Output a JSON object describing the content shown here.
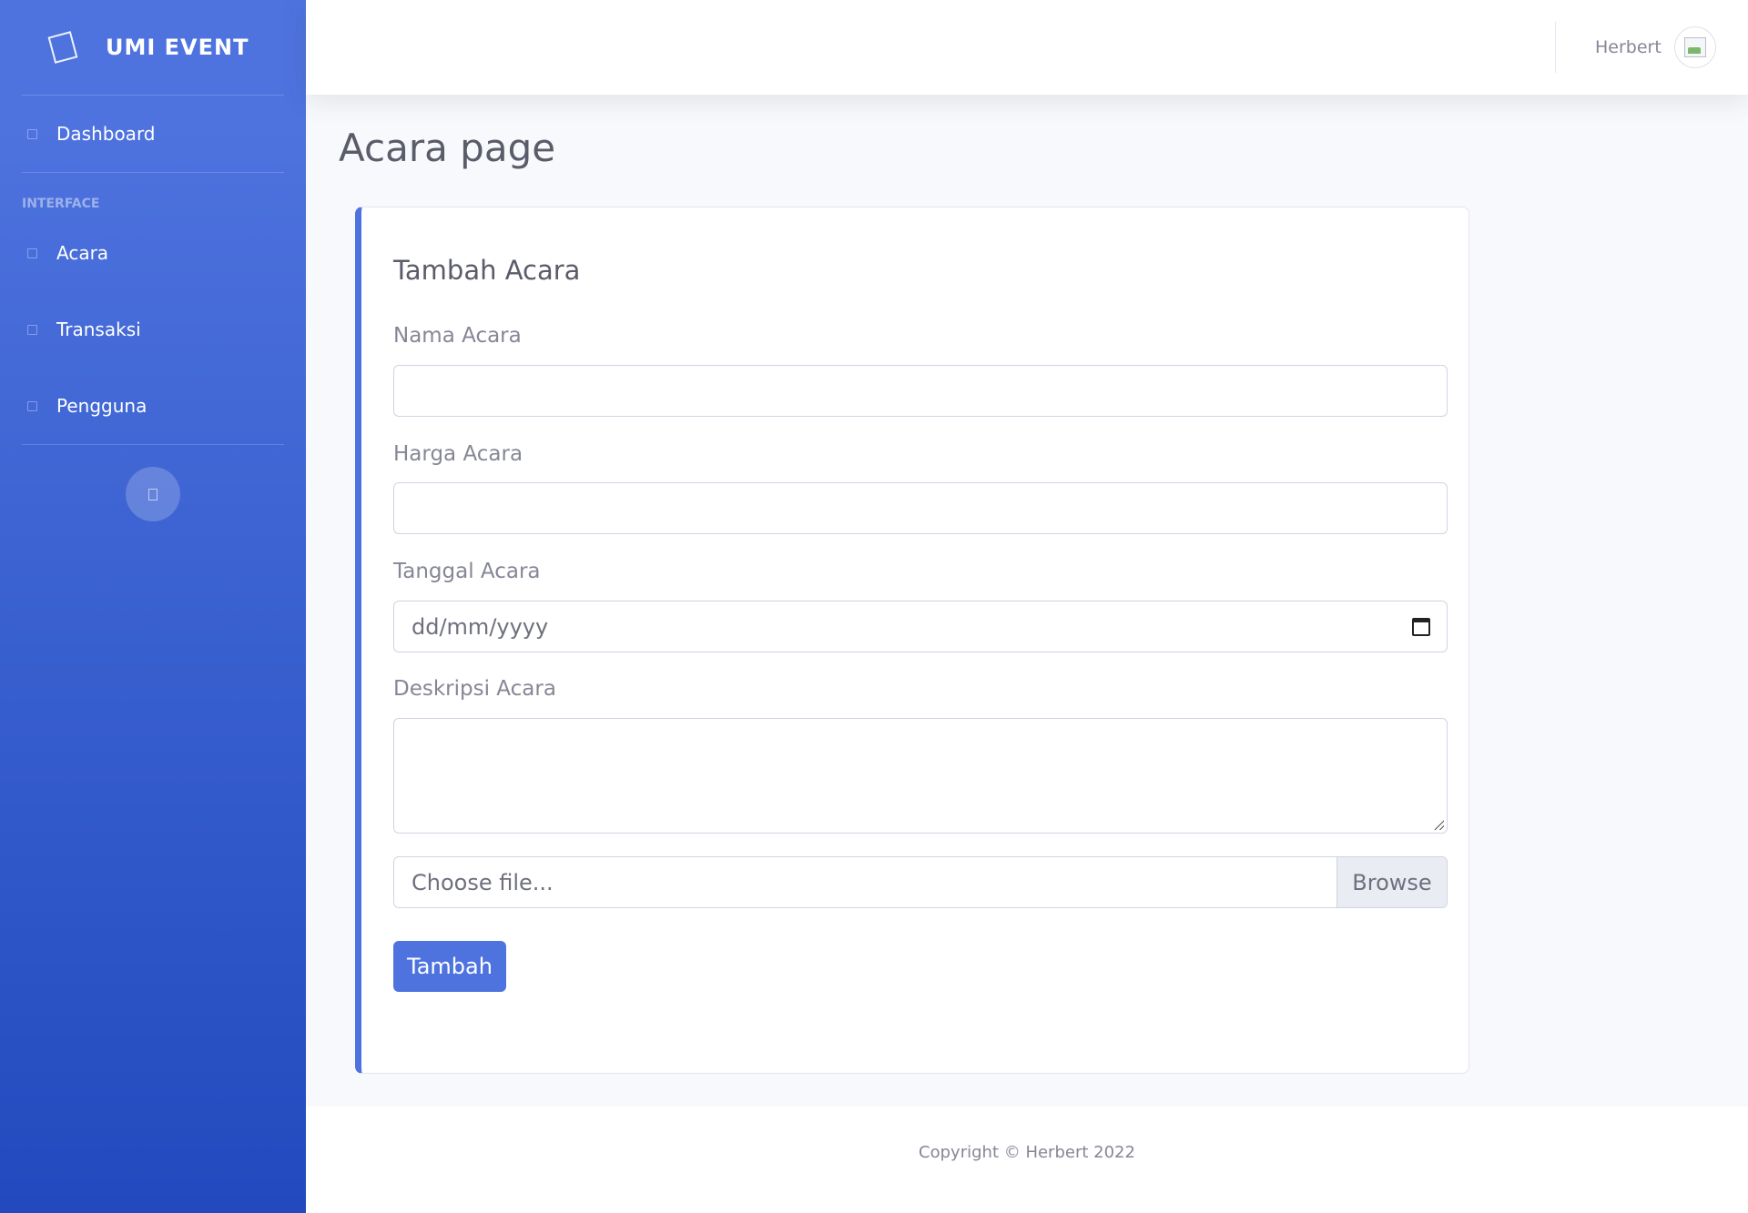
{
  "sidebar": {
    "brand": "UMI EVENT",
    "brand_icon": "laugh-wink-icon",
    "dashboard_label": "Dashboard",
    "section_heading": "Interface",
    "items": [
      {
        "label": "Acara",
        "icon": "event-icon"
      },
      {
        "label": "Transaksi",
        "icon": "transaction-icon"
      },
      {
        "label": "Pengguna",
        "icon": "user-icon"
      }
    ],
    "toggle_icon": "angle-left-icon"
  },
  "topbar": {
    "user_name": "Herbert",
    "avatar_icon": "broken-image-icon"
  },
  "page": {
    "title": "Acara page"
  },
  "form": {
    "title": "Tambah Acara",
    "nama_label": "Nama Acara",
    "nama_value": "",
    "harga_label": "Harga Acara",
    "harga_value": "",
    "tanggal_label": "Tanggal Acara",
    "tanggal_placeholder": "dd/mm/yyyy",
    "deskripsi_label": "Deskripsi Acara",
    "deskripsi_value": "",
    "file_label": "Choose file...",
    "browse_label": "Browse",
    "submit_label": "Tambah"
  },
  "footer": {
    "copyright": "Copyright © Herbert 2022"
  },
  "colors": {
    "primary": "#4e73df",
    "sidebar_gradient_end": "#224abe",
    "page_background": "#f8f9fc",
    "text_muted": "#858796"
  }
}
